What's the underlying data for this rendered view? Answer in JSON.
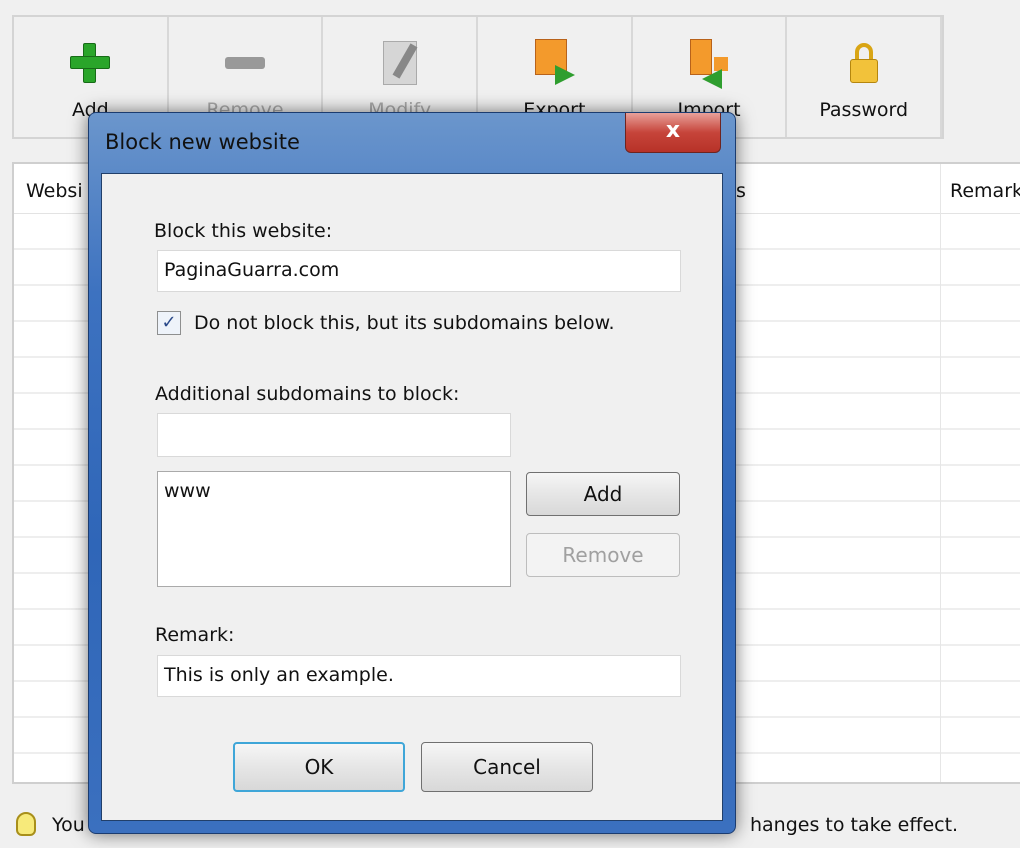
{
  "toolbar": {
    "items": [
      {
        "label": "Add",
        "icon": "plus-icon",
        "enabled": true
      },
      {
        "label": "Remove",
        "icon": "minus-icon",
        "enabled": false
      },
      {
        "label": "Modify",
        "icon": "edit-icon",
        "enabled": false
      },
      {
        "label": "Export",
        "icon": "export-icon",
        "enabled": true
      },
      {
        "label": "Import",
        "icon": "import-icon",
        "enabled": true
      },
      {
        "label": "Password",
        "icon": "lock-icon",
        "enabled": true
      }
    ]
  },
  "table": {
    "headers": [
      "Websi",
      "s",
      "Remark"
    ]
  },
  "status": {
    "left": "You",
    "right": "hanges to take effect."
  },
  "dialog": {
    "title": "Block new website",
    "close": "x",
    "block_label": "Block this website:",
    "block_value": "PaginaGuarra.com",
    "checkbox_label": "Do not block this, but its subdomains below.",
    "checkbox_checked": true,
    "sub_label": "Additional subdomains to block:",
    "sub_value": "",
    "sub_list": [
      "www"
    ],
    "add": "Add",
    "remove": "Remove",
    "remark_label": "Remark:",
    "remark_value": "This is only an example.",
    "ok": "OK",
    "cancel": "Cancel"
  }
}
